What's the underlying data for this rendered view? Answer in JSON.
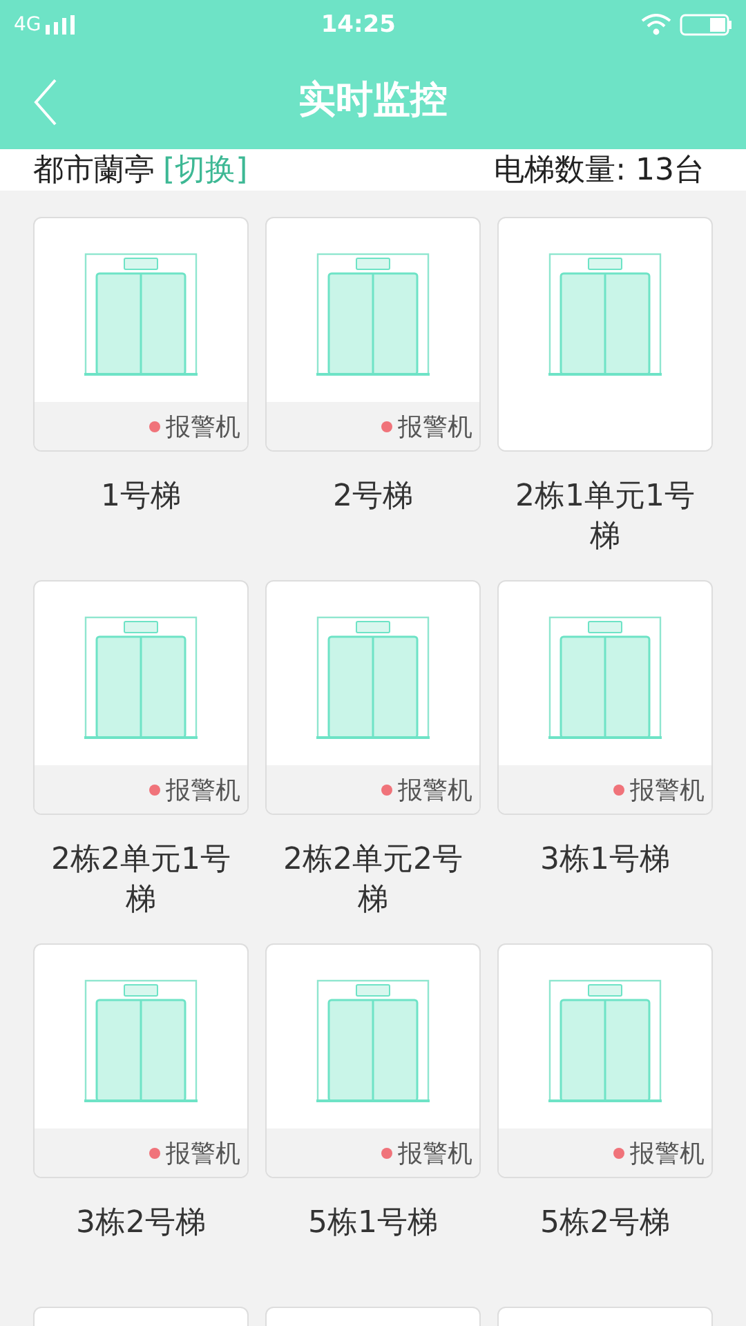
{
  "status_bar": {
    "network": "4G",
    "time": "14:25"
  },
  "header": {
    "title": "实时监控"
  },
  "info": {
    "community": "都市蘭亭",
    "switch_link": "[切换]",
    "count": "电梯数量: 13台"
  },
  "elevators": [
    {
      "kind": "card",
      "name": "1号梯",
      "alarm": true,
      "status": "报警机"
    },
    {
      "kind": "card",
      "name": "2号梯",
      "alarm": true,
      "status": "报警机"
    },
    {
      "kind": "card",
      "name": "2栋1单元1号梯",
      "alarm": false
    },
    {
      "kind": "card",
      "name": "2栋2单元1号梯",
      "alarm": true,
      "status": "报警机"
    },
    {
      "kind": "card",
      "name": "2栋2单元2号梯",
      "alarm": true,
      "status": "报警机"
    },
    {
      "kind": "card",
      "name": "3栋1号梯",
      "alarm": true,
      "status": "报警机"
    },
    {
      "kind": "card",
      "name": "3栋2号梯",
      "alarm": true,
      "status": "报警机"
    },
    {
      "kind": "card",
      "name": "5栋1号梯",
      "alarm": true,
      "status": "报警机"
    },
    {
      "kind": "card",
      "name": "5栋2号梯",
      "alarm": true,
      "status": "报警机"
    },
    {
      "kind": "cut"
    },
    {
      "kind": "cut"
    },
    {
      "kind": "cut"
    }
  ]
}
